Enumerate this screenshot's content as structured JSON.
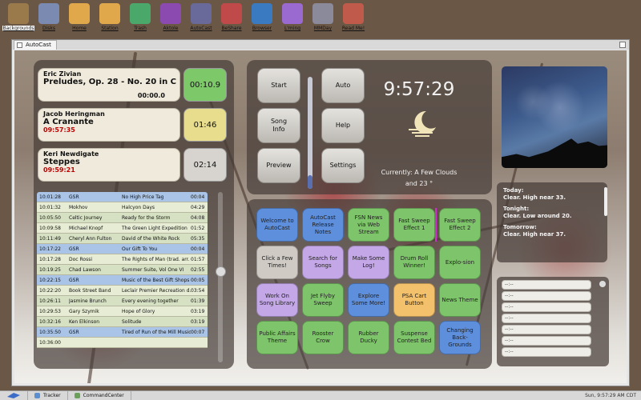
{
  "desktop_icons": [
    {
      "label": "Backgrounds",
      "name": "backgrounds-icon",
      "color": "#9a7a4a"
    },
    {
      "label": "Disks",
      "name": "disks-icon",
      "color": "#7a8ab0"
    },
    {
      "label": "Home",
      "name": "home-folder-icon",
      "color": "#e0a84b"
    },
    {
      "label": "Station",
      "name": "station-folder-icon",
      "color": "#e0a84b"
    },
    {
      "label": "Trash",
      "name": "trash-icon",
      "color": "#4aa86a"
    },
    {
      "label": "Aktole",
      "name": "aktole-icon",
      "color": "#8a4ab0"
    },
    {
      "label": "AutoCast",
      "name": "autocast-icon",
      "color": "#6a6a9a"
    },
    {
      "label": "BeShare",
      "name": "beshare-icon",
      "color": "#c04a4a"
    },
    {
      "label": "Browser",
      "name": "browser-icon",
      "color": "#3a7ac0"
    },
    {
      "label": "L'ming",
      "name": "lming-icon",
      "color": "#9a6ad0"
    },
    {
      "label": "MMDay",
      "name": "mmday-icon",
      "color": "#8a8a9a"
    },
    {
      "label": "Read Me!",
      "name": "readme-icon",
      "color": "#c05a4a"
    }
  ],
  "window": {
    "tab_title": "AutoCast"
  },
  "now_playing": [
    {
      "artist": "Eric Zivian",
      "title": "Preludes, Op. 28 - No. 20 in C min...",
      "time": "00:00.0",
      "time_color": "#111111",
      "countdown": "00:10.9",
      "countdown_color": "#7dc96a"
    },
    {
      "artist": "Jacob Heringman",
      "title": "A Cranante",
      "time": "09:57:35",
      "time_color": "#c00000",
      "countdown": "01:46",
      "countdown_color": "#e8dd8c"
    },
    {
      "artist": "Keri Newdigate",
      "title": "Steppes",
      "time": "09:59:21",
      "time_color": "#c00000",
      "countdown": "02:14",
      "countdown_color": "#d7d4cf"
    }
  ],
  "log_rows": [
    {
      "time": "10:01:28",
      "artist": "GSR",
      "title": "No High Price Tag",
      "dur": "00:04",
      "style": "blue"
    },
    {
      "time": "10:01:32",
      "artist": "Mokhov",
      "title": "Halcyon Days",
      "dur": "04:29",
      "style": "odd"
    },
    {
      "time": "10:05:50",
      "artist": "Celtic Journey",
      "title": "Ready for the Storm",
      "dur": "04:08",
      "style": "even"
    },
    {
      "time": "10:09:58",
      "artist": "Michael Knopf",
      "title": "The Green Light Expedition",
      "dur": "01:52",
      "style": "odd"
    },
    {
      "time": "10:11:49",
      "artist": "Cheryl Ann Fulton",
      "title": "David of the White Rock",
      "dur": "05:35",
      "style": "even"
    },
    {
      "time": "10:17:22",
      "artist": "GSR",
      "title": "Our Gift To You",
      "dur": "00:04",
      "style": "blue"
    },
    {
      "time": "10:17:28",
      "artist": "Doc Rossi",
      "title": "The Rights of Man (trad. arr.",
      "dur": "01:57",
      "style": "odd"
    },
    {
      "time": "10:19:25",
      "artist": "Chad Lawson",
      "title": "Summer Suite, Vol One VI",
      "dur": "02:55",
      "style": "even"
    },
    {
      "time": "10:22:15",
      "artist": "GSR",
      "title": "Music of the Best Gift Shops",
      "dur": "00:05",
      "style": "blue"
    },
    {
      "time": "10:22:20",
      "artist": "Book Street Band",
      "title": "Leclair Premier Recreation d...",
      "dur": "03:54",
      "style": "odd"
    },
    {
      "time": "10:26:11",
      "artist": "Jasmine Brunch",
      "title": "Every evening together",
      "dur": "01:39",
      "style": "even"
    },
    {
      "time": "10:29:53",
      "artist": "Gary Szymik",
      "title": "Hope of Glory",
      "dur": "03:19",
      "style": "odd"
    },
    {
      "time": "10:32:16",
      "artist": "Ken Elkinson",
      "title": "Solitude",
      "dur": "03:19",
      "style": "even"
    },
    {
      "time": "10:35:50",
      "artist": "GSR",
      "title": "Tired of Run of the Mill Music",
      "dur": "00:07",
      "style": "blue"
    },
    {
      "time": "10:36:00",
      "artist": "",
      "title": "",
      "dur": "",
      "style": "odd"
    }
  ],
  "controls": {
    "start": "Start",
    "auto": "Auto",
    "song_info": "Song\nInfo",
    "help": "Help",
    "preview": "Preview",
    "settings": "Settings",
    "volume_level": 0.12
  },
  "clock": {
    "time": "9:57:29"
  },
  "weather": {
    "line1": "Currently: A Few Clouds",
    "line2": "and 23 °"
  },
  "tiles": [
    {
      "label": "Welcome to AutoCast",
      "color": "blue"
    },
    {
      "label": "AutoCast Release Notes",
      "color": "blue"
    },
    {
      "label": "FSN News via Web Stream",
      "color": "green"
    },
    {
      "label": "Fast Sweep Effect 1",
      "color": "green"
    },
    {
      "label": "Fast Sweep Effect 2",
      "color": "green"
    },
    {
      "label": "Click a Few Times!",
      "color": "gray"
    },
    {
      "label": "Search for Songs",
      "color": "lav"
    },
    {
      "label": "Make Some Log!",
      "color": "lav"
    },
    {
      "label": "Drum Roll Winner!",
      "color": "green"
    },
    {
      "label": "Explo-sion",
      "color": "green"
    },
    {
      "label": "Work On Song Library",
      "color": "lav"
    },
    {
      "label": "Jet Flyby Sweep",
      "color": "green"
    },
    {
      "label": "Explore Some More!",
      "color": "blue"
    },
    {
      "label": "PSA Cart Button",
      "color": "orange"
    },
    {
      "label": "News Theme",
      "color": "green"
    },
    {
      "label": "Public Affairs Theme",
      "color": "green"
    },
    {
      "label": "Rooster Crow",
      "color": "green"
    },
    {
      "label": "Rubber Ducky",
      "color": "green"
    },
    {
      "label": "Suspense Contest Bed",
      "color": "green"
    },
    {
      "label": "Changing Back-Grounds",
      "color": "blue"
    }
  ],
  "forecast": {
    "today_label": "Today:",
    "today_text": "Clear. High near 33.",
    "tonight_label": "Tonight:",
    "tonight_text": "Clear. Low around 20.",
    "tomorrow_label": "Tomorrow:",
    "tomorrow_text": "Clear. High near 37."
  },
  "slots": [
    "--:--",
    "--:--",
    "--:--",
    "--:--",
    "--:--",
    "--:--",
    "--:--"
  ],
  "taskbar": {
    "items": [
      {
        "label": "Tracker",
        "color": "#5b8fd0"
      },
      {
        "label": "CommandCenter",
        "color": "#6aa05a"
      }
    ],
    "clock": "Sun, 9:57:29 AM CDT"
  }
}
